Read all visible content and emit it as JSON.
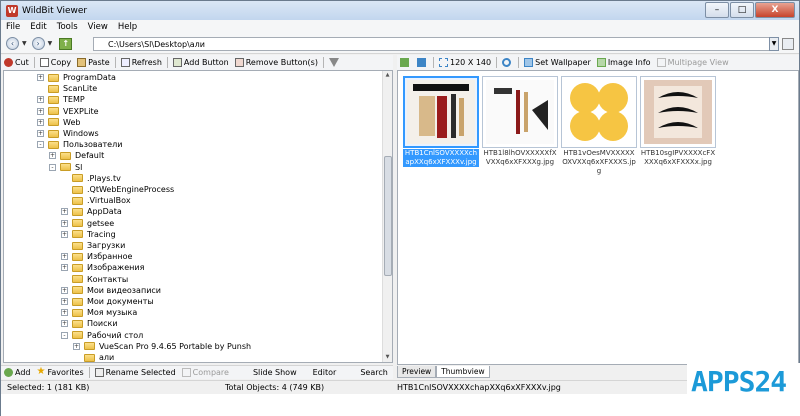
{
  "window": {
    "title": "WildBit Viewer",
    "minimize": "–",
    "maximize": "□",
    "close": "X"
  },
  "menu": [
    "File",
    "Edit",
    "Tools",
    "View",
    "Help"
  ],
  "address": {
    "path": "C:\\Users\\Sl\\Desktop\\али"
  },
  "left_toolbar": {
    "cut": "Cut",
    "copy": "Copy",
    "paste": "Paste",
    "refresh": "Refresh",
    "add_button": "Add Button",
    "remove_buttons": "Remove Button(s)"
  },
  "right_toolbar": {
    "size": "120 X 140",
    "set_wallpaper": "Set Wallpaper",
    "image_info": "Image Info",
    "multipage": "Multipage View"
  },
  "tree": [
    {
      "label": "ProgramData",
      "depth": 1,
      "exp": "+"
    },
    {
      "label": "ScanLite",
      "depth": 1,
      "exp": ""
    },
    {
      "label": "TEMP",
      "depth": 1,
      "exp": "+"
    },
    {
      "label": "VEXPLite",
      "depth": 1,
      "exp": "+"
    },
    {
      "label": "Web",
      "depth": 1,
      "exp": "+"
    },
    {
      "label": "Windows",
      "depth": 1,
      "exp": "+"
    },
    {
      "label": "Пользователи",
      "depth": 1,
      "exp": "-"
    },
    {
      "label": "Default",
      "depth": 2,
      "exp": "+"
    },
    {
      "label": "Sl",
      "depth": 2,
      "exp": "-"
    },
    {
      "label": ".Plays.tv",
      "depth": 3,
      "exp": ""
    },
    {
      "label": ".QtWebEngineProcess",
      "depth": 3,
      "exp": ""
    },
    {
      "label": ".VirtualBox",
      "depth": 3,
      "exp": ""
    },
    {
      "label": "AppData",
      "depth": 3,
      "exp": "+"
    },
    {
      "label": "getsee",
      "depth": 3,
      "exp": "+"
    },
    {
      "label": "Tracing",
      "depth": 3,
      "exp": "+"
    },
    {
      "label": "Загрузки",
      "depth": 3,
      "exp": ""
    },
    {
      "label": "Избранное",
      "depth": 3,
      "exp": "+"
    },
    {
      "label": "Изображения",
      "depth": 3,
      "exp": "+"
    },
    {
      "label": "Контакты",
      "depth": 3,
      "exp": ""
    },
    {
      "label": "Мои видеозаписи",
      "depth": 3,
      "exp": "+"
    },
    {
      "label": "Мои документы",
      "depth": 3,
      "exp": "+"
    },
    {
      "label": "Моя музыка",
      "depth": 3,
      "exp": "+"
    },
    {
      "label": "Поиски",
      "depth": 3,
      "exp": "+"
    },
    {
      "label": "Рабочий стол",
      "depth": 3,
      "exp": "-"
    },
    {
      "label": "VueScan Pro 9.4.65 Portable by Punsh",
      "depth": 4,
      "exp": "+"
    },
    {
      "label": "али",
      "depth": 4,
      "exp": ""
    }
  ],
  "bottom_toolbar": {
    "add": "Add",
    "favorites": "Favorites",
    "rename": "Rename Selected",
    "compare": "Compare",
    "slideshow": "Slide Show",
    "editor": "Editor",
    "search": "Search"
  },
  "thumbnails": [
    {
      "caption": "HTB1CnlSOVXXXXchapXXq6xXFXXXv.jpg",
      "selected": true
    },
    {
      "caption": "HTB1l8lhOVXXXXXfXVXXq6xXFXXXg.jpg",
      "selected": false
    },
    {
      "caption": "HTB1vOesMVXXXXXOXVXXq6xXFXXXS.jpg",
      "selected": false
    },
    {
      "caption": "HTB10sgIPVXXXXcFXXXXq6xXFXXXx.jpg",
      "selected": false
    }
  ],
  "tabs": {
    "preview": "Preview",
    "thumbview": "Thumbview"
  },
  "status": {
    "selected": "Selected: 1 (181 KB)",
    "total": "Total Objects: 4 (749 KB)",
    "file": "HTB1CnlSOVXXXXchapXXq6xXFXXXv.jpg"
  },
  "watermark": {
    "apps": "APPS",
    "num": "24"
  },
  "colors": {
    "accent": "#3399ff",
    "watermark": "#1c9ad8"
  }
}
